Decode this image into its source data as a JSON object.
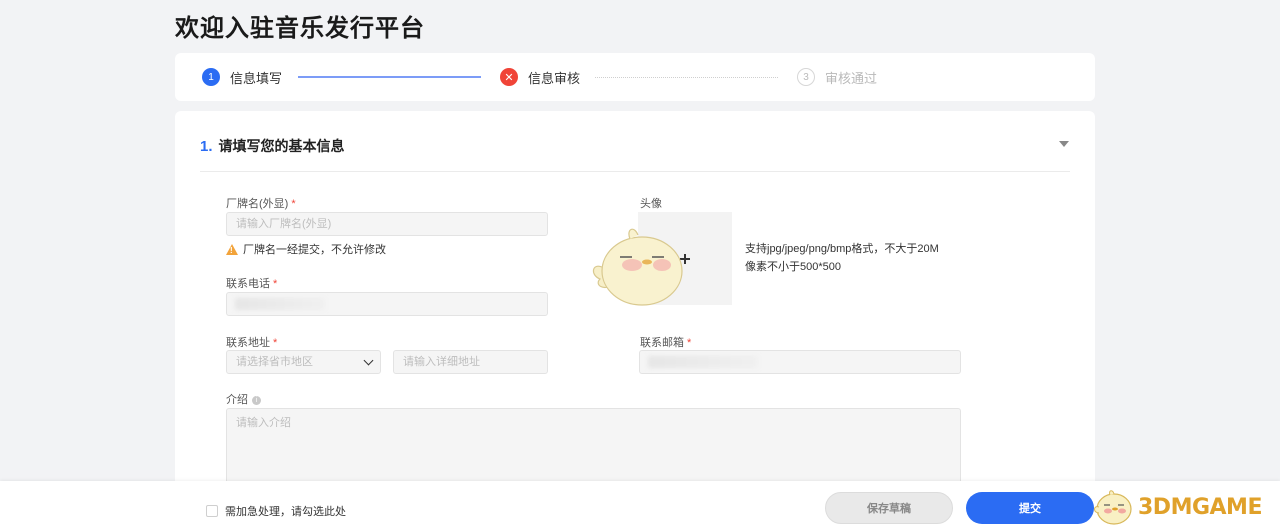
{
  "page": {
    "title": "欢迎入驻音乐发行平台"
  },
  "steps": [
    {
      "number": "1",
      "label": "信息填写",
      "state": "done"
    },
    {
      "number": "✕",
      "label": "信息审核",
      "state": "error"
    },
    {
      "number": "3",
      "label": "审核通过",
      "state": "pending"
    }
  ],
  "section": {
    "number": "1.",
    "title": "请填写您的基本信息"
  },
  "form": {
    "brand_name": {
      "label": "厂牌名(外显)",
      "required": "*",
      "placeholder": "请输入厂牌名(外显)"
    },
    "brand_warning": "厂牌名一经提交，不允许修改",
    "phone": {
      "label": "联系电话",
      "required": "*"
    },
    "address": {
      "label": "联系地址",
      "required": "*",
      "region_placeholder": "请选择省市地区",
      "detail_placeholder": "请输入详细地址"
    },
    "avatar": {
      "label": "头像",
      "hint_line1": "支持jpg/jpeg/png/bmp格式，不大于20M",
      "hint_line2": "像素不小于500*500"
    },
    "email": {
      "label": "联系邮箱",
      "required": "*"
    },
    "intro": {
      "label": "介绍",
      "placeholder": "请输入介绍"
    }
  },
  "footer": {
    "urgent_label": "需加急处理，请勾选此处",
    "save_label": "保存草稿",
    "submit_label": "提交"
  },
  "watermark": {
    "text": "3DMGAME"
  },
  "colors": {
    "accent": "#2b6cf3",
    "error": "#f04438",
    "warning": "#f2a33a",
    "watermark": "#e0a12a"
  }
}
